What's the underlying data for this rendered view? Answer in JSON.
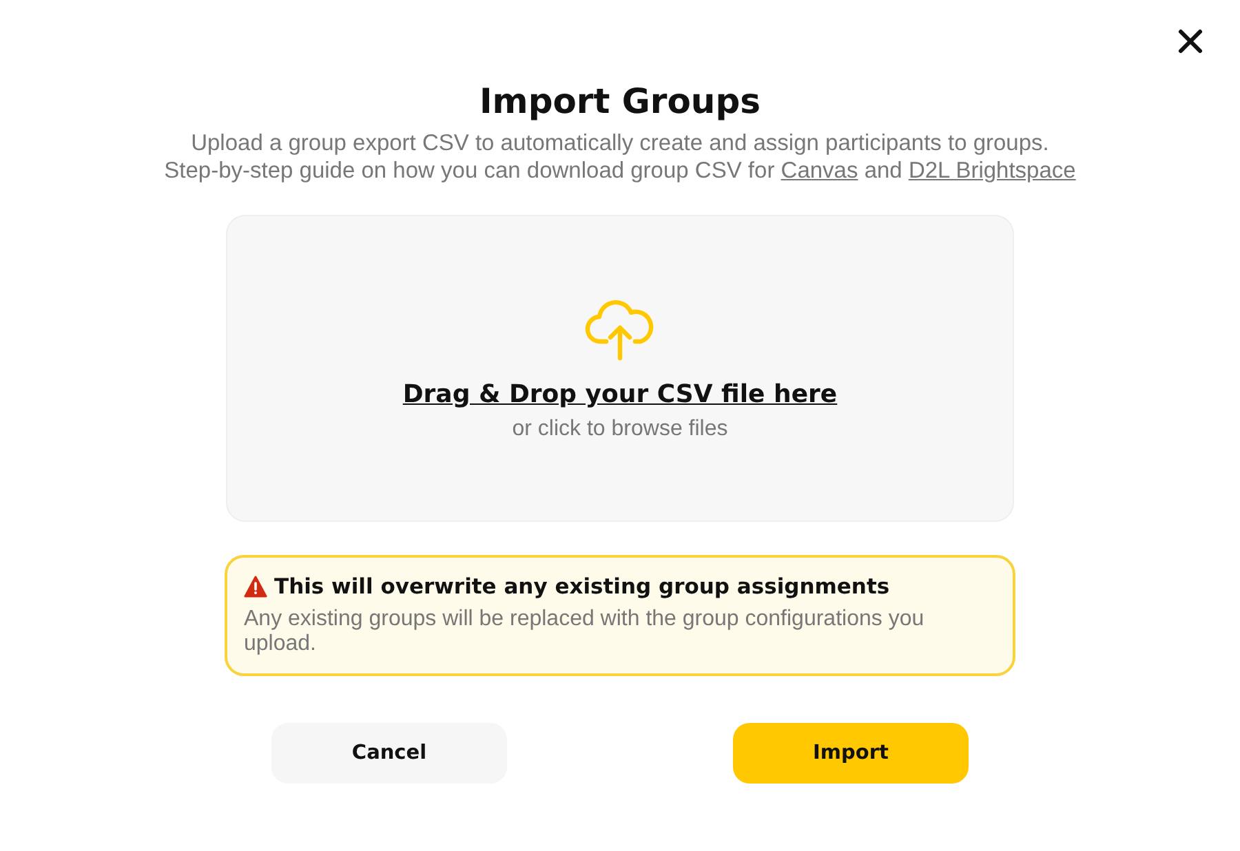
{
  "dialog": {
    "title": "Import Groups",
    "description": {
      "line_1": "Upload a group export CSV to automatically create and assign participants to groups.",
      "line_2": "Step-by-step guide on how you can download group CSV for",
      "links": [
        "Canvas",
        "D2L Brightspace"
      ],
      "joiner": "and"
    }
  },
  "dropzone": {
    "heading": "Drag & Drop your CSV file here",
    "hint": "or click to browse files"
  },
  "warning": {
    "title": "This will overwrite any existing group assignments",
    "message": "Any existing groups will be replaced with the group configurations you upload."
  },
  "buttons": [
    {
      "label": "Cancel",
      "kind": "secondary"
    },
    {
      "label": "Import",
      "kind": "primary"
    }
  ]
}
